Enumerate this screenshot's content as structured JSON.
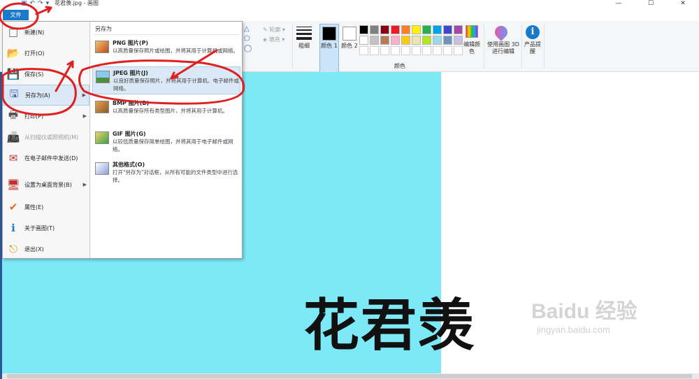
{
  "window": {
    "title": "花君羡.jpg - 画图",
    "controls": [
      "—",
      "☐",
      "✕"
    ]
  },
  "quick_access": {
    "save_icon": "floppy-icon",
    "undo_icon": "undo-icon",
    "redo_icon": "redo-icon",
    "customize_glyph": "▾"
  },
  "file_tab": {
    "label": "文件"
  },
  "ribbon": {
    "outline_label": "轮廓",
    "fill_label": "填充",
    "thickness_label": "粗细",
    "color1_label": "颜色 1",
    "color2_label": "颜色 2",
    "edit_colors_label": "编辑颜色",
    "paint3d_label": "使用画图 3D 进行编辑",
    "product_alert_label": "产品提醒",
    "colors_group_label": "颜色",
    "palette_row1": [
      "#000000",
      "#7f7f7f",
      "#880015",
      "#ed1c24",
      "#ff7f27",
      "#fff200",
      "#22b14c",
      "#00a2e8",
      "#3f48cc",
      "#a349a4"
    ],
    "palette_row2": [
      "#ffffff",
      "#c3c3c3",
      "#b97a57",
      "#ffaec9",
      "#ffc90e",
      "#efe4b0",
      "#b5e61d",
      "#99d9ea",
      "#7092be",
      "#c8bfe7"
    ]
  },
  "file_menu": {
    "items": [
      {
        "label": "新建(N)",
        "icon": "new-file-icon",
        "glyph": "□",
        "disabled": false
      },
      {
        "label": "打开(O)",
        "icon": "open-folder-icon",
        "glyph": "📂",
        "disabled": false
      },
      {
        "label": "保存(S)",
        "icon": "save-icon",
        "glyph": "💾",
        "disabled": false
      },
      {
        "label": "另存为(A)",
        "icon": "save-as-icon",
        "glyph": "🖫",
        "disabled": false,
        "submenu": true
      },
      {
        "label": "打印(P)",
        "icon": "print-icon",
        "glyph": "🖶",
        "disabled": false,
        "submenu": true
      },
      {
        "label": "从扫描仪或照相机(M)",
        "icon": "scanner-icon",
        "glyph": "📠",
        "disabled": true
      },
      {
        "label": "在电子邮件中发送(D)",
        "icon": "email-icon",
        "glyph": "✉",
        "disabled": false
      },
      {
        "label": "设置为桌面背景(B)",
        "icon": "desktop-background-icon",
        "glyph": "🖥",
        "disabled": false,
        "submenu": true
      },
      {
        "label": "属性(E)",
        "icon": "properties-check-icon",
        "glyph": "✔",
        "disabled": false
      },
      {
        "label": "关于画图(T)",
        "icon": "info-icon",
        "glyph": "ℹ",
        "disabled": false
      },
      {
        "label": "退出(X)",
        "icon": "exit-icon",
        "glyph": "⎋",
        "disabled": false
      }
    ],
    "submenu_title": "另存为",
    "save_as_options": [
      {
        "title": "PNG 图片(P)",
        "desc": "以高质量保存照片或绘图，并将其用于计算机或网络。",
        "icon": "png-image-icon"
      },
      {
        "title": "JPEG 图片(J)",
        "desc": "以良好质量保存照片，并将其用于计算机、电子邮件或网络。",
        "icon": "jpeg-image-icon"
      },
      {
        "title": "BMP 图片(B)",
        "desc": "以高质量保存所有类型图片，并将其用于计算机。",
        "icon": "bmp-image-icon"
      },
      {
        "title": "GIF 图片(G)",
        "desc": "以较低质量保存简单绘图，并将其用于电子邮件或网络。",
        "icon": "gif-image-icon"
      },
      {
        "title": "其他格式(O)",
        "desc": "打开\"另存为\"对话框，从所有可能的文件类型中进行选择。",
        "icon": "other-formats-icon"
      }
    ]
  },
  "canvas": {
    "text": "花君羡",
    "left_color": "#7de9f7",
    "right_color": "#ffffff"
  },
  "watermark": {
    "main": "Baidu 经验",
    "sub": "jingyan.baidu.com"
  }
}
